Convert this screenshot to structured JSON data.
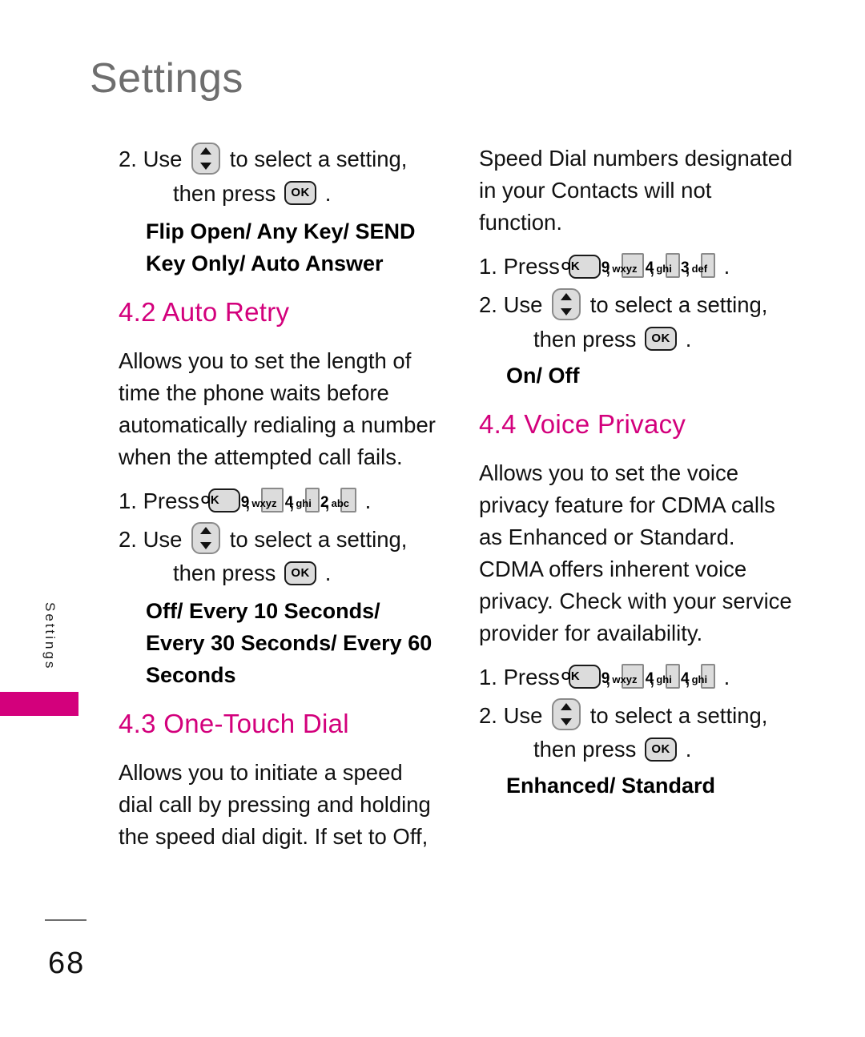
{
  "page": {
    "chapter_title": "Settings",
    "side_tab_label": "Settings",
    "page_number": "68",
    "accent_color": "#d3007c",
    "title_color": "#6e6e6e"
  },
  "keys": {
    "ok": "OK",
    "nav_up_icon": "triangle-up-icon",
    "nav_down_icon": "triangle-down-icon",
    "k9": {
      "digit": "9",
      "letters": "wxyz"
    },
    "k4": {
      "digit": "4",
      "letters": "ghi"
    },
    "k3": {
      "digit": "3",
      "letters": "def"
    },
    "k2": {
      "digit": "2",
      "letters": "abc"
    }
  },
  "left_column": {
    "step2_prefix": "2. Use",
    "step2_mid": "to select a setting,",
    "step2_cont": "then press",
    "step2_period": ".",
    "options_flip": "Flip Open/ Any Key/ SEND Key Only/ Auto Answer",
    "section_42": "4.2 Auto Retry",
    "body_42": "Allows you to set the length of time the phone waits before automatically redialing a number when the attempted call fails.",
    "step1_prefix": "1. Press",
    "step1_period": ".",
    "step2b_prefix": "2. Use",
    "step2b_mid": "to select a setting,",
    "step2b_cont": "then press",
    "step2b_period": ".",
    "options_retry": "Off/ Every 10 Seconds/ Every 30 Seconds/ Every 60 Seconds",
    "section_43": "4.3 One-Touch Dial",
    "body_43": "Allows you to initiate a speed dial call by pressing and holding the speed dial digit. If set to Off,"
  },
  "right_column": {
    "body_43_cont": "Speed Dial numbers designated in your Contacts will not function.",
    "step1_prefix": "1. Press",
    "step1_period": ".",
    "step2_prefix": "2. Use",
    "step2_mid": "to select a setting,",
    "step2_cont": "then press",
    "step2_period": ".",
    "options_onoff": "On/ Off",
    "section_44": "4.4 Voice Privacy",
    "body_44": "Allows you to set the voice privacy feature for CDMA calls as Enhanced or Standard. CDMA offers inherent voice privacy. Check with your service provider for availability.",
    "step1b_prefix": "1. Press",
    "step1b_period": ".",
    "step2b_prefix": "2. Use",
    "step2b_mid": "to select a setting,",
    "step2b_cont": "then press",
    "step2b_period": ".",
    "options_enhanced": "Enhanced/ Standard"
  }
}
